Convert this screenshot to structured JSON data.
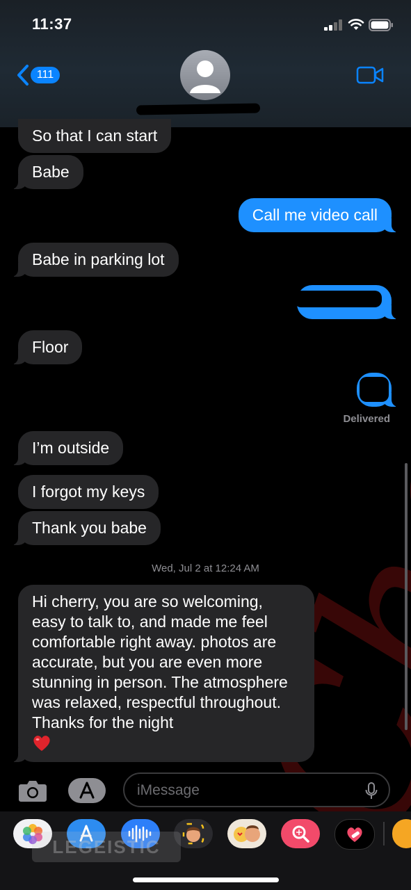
{
  "status_bar": {
    "time": "11:37"
  },
  "header": {
    "back_count": "111"
  },
  "messages": [
    {
      "text": "So that I can start",
      "dir": "in"
    },
    {
      "text": "Babe",
      "dir": "in"
    },
    {
      "text": "Call me video call",
      "dir": "out"
    },
    {
      "text": "Babe in parking lot",
      "dir": "in"
    },
    {
      "text": "Floor",
      "dir": "in"
    },
    {
      "text": "I’m outside",
      "dir": "in"
    },
    {
      "text": "I forgot my keys",
      "dir": "in"
    },
    {
      "text": "Thank you babe",
      "dir": "in"
    }
  ],
  "delivered_label": "Delivered",
  "timestamp": "Wed, Jul 2 at 12:24 AM",
  "long_message": "Hi cherry, you are so welcoming, easy to talk to, and made me feel comfortable right away. photos are accurate, but you are even more stunning in person. The atmosphere was relaxed, respectful throughout. Thanks for the night",
  "watermark_text": "Cherry",
  "input": {
    "placeholder": "iMessage"
  },
  "colors": {
    "accent": "#0a84ff",
    "incoming": "#262628",
    "outgoing": "#1e90ff"
  },
  "app_drawer": [
    "photos-app",
    "app-store",
    "audio-message",
    "memoji",
    "animoji-stickers",
    "image-search",
    "digital-touch",
    "more-apps"
  ],
  "drawer_watermark": "LEGEISTIC"
}
